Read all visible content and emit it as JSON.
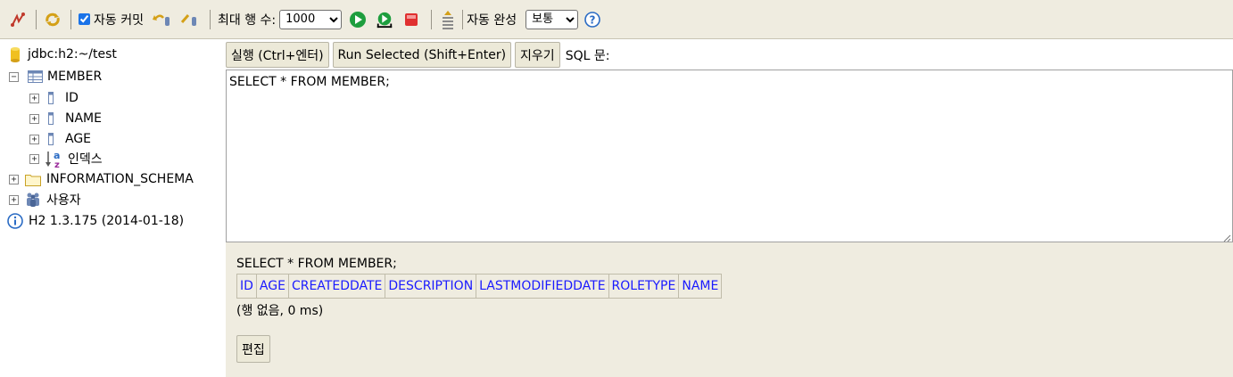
{
  "toolbar": {
    "auto_commit_label": "자동 커밋",
    "auto_commit_checked": true,
    "max_rows_label": "최대 행 수:",
    "max_rows_value": "1000",
    "auto_complete_label": "자동 완성",
    "auto_complete_value": "보통",
    "icons": [
      "disconnect-icon",
      "refresh-icon",
      "rollback-icon",
      "commit-icon",
      "run-icon",
      "run-selected-icon",
      "stop-icon",
      "history-icon",
      "help-icon"
    ]
  },
  "tree": {
    "connection": "jdbc:h2:~/test",
    "table": "MEMBER",
    "columns": [
      "ID",
      "NAME",
      "AGE"
    ],
    "indexes_label": "인덱스",
    "schema": "INFORMATION_SCHEMA",
    "users_label": "사용자",
    "version": "H2 1.3.175 (2014-01-18)"
  },
  "query_bar": {
    "run_label": "실행 (Ctrl+엔터)",
    "run_selected_label": "Run Selected (Shift+Enter)",
    "clear_label": "지우기",
    "sql_label": "SQL 문:"
  },
  "editor": {
    "sql": "SELECT * FROM MEMBER;"
  },
  "results": {
    "sql": "SELECT * FROM MEMBER;",
    "columns": [
      "ID",
      "AGE",
      "CREATEDDATE",
      "DESCRIPTION",
      "LASTMODIFIEDDATE",
      "ROLETYPE",
      "NAME"
    ],
    "count_text": "(행 없음, 0 ms)",
    "edit_label": "편집"
  },
  "colors": {
    "toolbar_bg": "#efece0",
    "header_link": "#1a1aff"
  }
}
